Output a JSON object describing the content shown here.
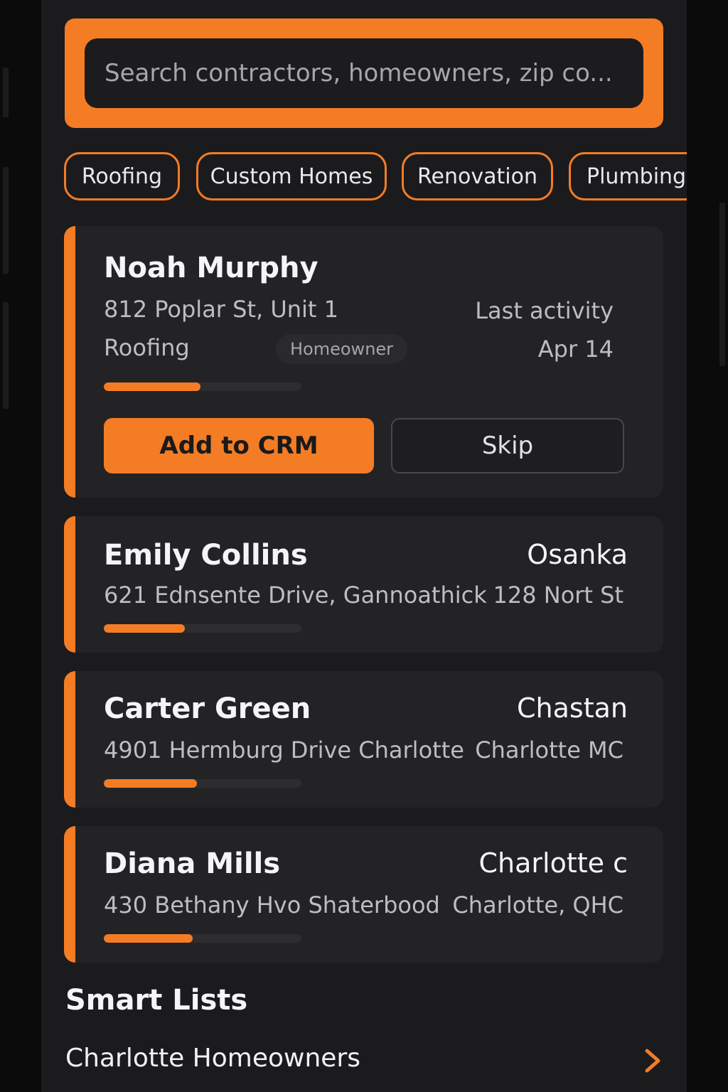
{
  "search": {
    "placeholder": "Search contractors, homeowners, zip co..."
  },
  "filters": [
    {
      "label": "Roofing"
    },
    {
      "label": "Custom Homes"
    },
    {
      "label": "Renovation"
    },
    {
      "label": "Plumbing"
    }
  ],
  "leads": [
    {
      "name": "Noah Murphy",
      "address": "812 Poplar St, Unit 1",
      "category": "Roofing",
      "badge": "Homeowner",
      "activity_label": "Last activity",
      "activity_date": "Apr 14",
      "progress": 0.49,
      "primary_action": "Add to CRM",
      "secondary_action": "Skip"
    },
    {
      "name": "Emily Collins",
      "address": "621 Ednsente  Drive, Gannoathick",
      "right_title": "Osanka",
      "right_sub": "128 Nort St",
      "progress": 0.41
    },
    {
      "name": "Carter Green",
      "address": "4901 Hermburg Drive  Charlotte",
      "right_title": "Chastan",
      "right_sub": "Charlotte MC",
      "progress": 0.47
    },
    {
      "name": "Diana Mills",
      "address": "430 Bethany Hvo  Shaterbood",
      "right_title": "Charlotte c",
      "right_sub": "Charlotte, QHC",
      "progress": 0.45
    }
  ],
  "smart_lists": {
    "title": "Smart Lists",
    "items": [
      {
        "label": "Charlotte Homeowners",
        "icon": "chevron-right-icon"
      }
    ]
  },
  "colors": {
    "accent": "#f47c25",
    "card": "#232325",
    "background": "#1b1b1d"
  }
}
